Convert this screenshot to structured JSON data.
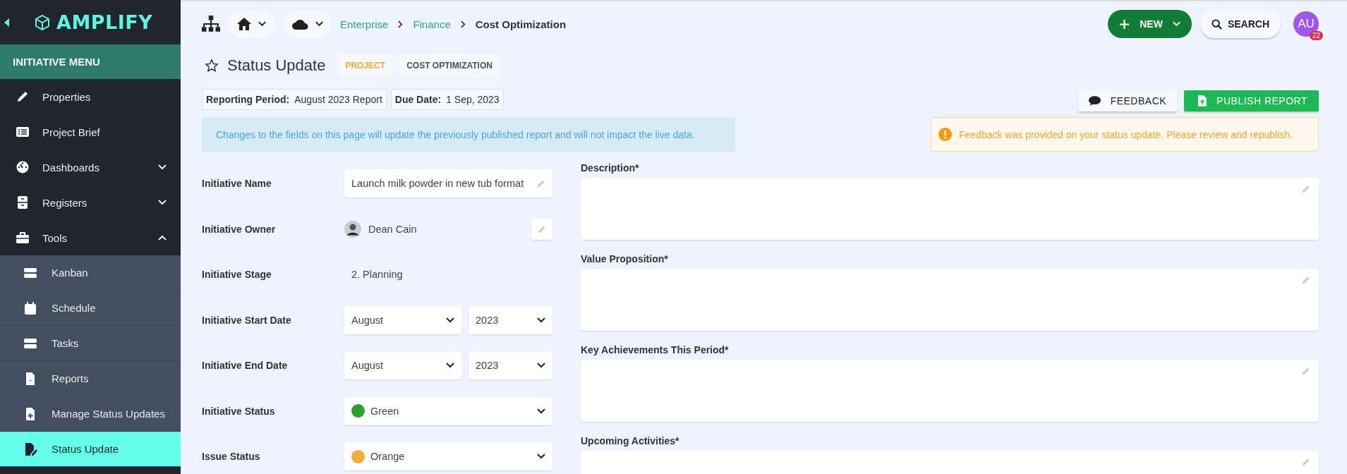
{
  "sidebar": {
    "brand": "AMPLIFY",
    "menu_title": "INITIATIVE MENU",
    "items": [
      {
        "label": "Properties",
        "selected": false
      },
      {
        "label": "Project Brief",
        "selected": false
      },
      {
        "label": "Dashboards",
        "selected": false,
        "expanded": false
      },
      {
        "label": "Registers",
        "selected": false,
        "expanded": false
      },
      {
        "label": "Tools",
        "selected": false,
        "expanded": true,
        "children": [
          {
            "label": "Kanban",
            "selected": false
          },
          {
            "label": "Schedule",
            "selected": false
          },
          {
            "label": "Tasks",
            "selected": false
          },
          {
            "label": "Reports",
            "selected": false
          },
          {
            "label": "Manage Status Updates",
            "selected": false
          },
          {
            "label": "Status Update",
            "selected": true
          }
        ]
      }
    ]
  },
  "topbar": {
    "breadcrumb": [
      "Enterprise",
      "Finance",
      "Cost Optimization"
    ],
    "new_button": "NEW",
    "search_button": "SEARCH",
    "avatar": {
      "initials": "AU",
      "badge": "22"
    }
  },
  "page": {
    "title": "Status Update",
    "starred": false,
    "tags": [
      {
        "label": "PROJECT",
        "color": "#f2a93b"
      },
      {
        "label": "COST OPTIMIZATION",
        "color": "#4a5160"
      }
    ],
    "meta": [
      {
        "label": "Reporting Period:",
        "value": "August 2023 Report"
      },
      {
        "label": "Due Date:",
        "value": "1 Sep, 2023"
      }
    ],
    "buttons": {
      "feedback": "FEEDBACK",
      "publish": "PUBLISH REPORT"
    },
    "info_banner": "Changes to the fields on this page will update the previously published report and will not impact the live data.",
    "alert": "Feedback was provided on your status update. Please review and republish."
  },
  "fields": [
    {
      "kind": "text",
      "label": "Initiative Name",
      "value": "Launch milk powder in new tub format"
    },
    {
      "kind": "person",
      "label": "Initiative Owner",
      "value": "Dean Cain"
    },
    {
      "kind": "static",
      "label": "Initiative Stage",
      "value": "2. Planning"
    },
    {
      "kind": "month_year",
      "label": "Initiative Start Date",
      "month": "August",
      "year": "2023"
    },
    {
      "kind": "month_year",
      "label": "Initiative End Date",
      "month": "August",
      "year": "2023"
    },
    {
      "kind": "status",
      "label": "Initiative Status",
      "value": "Green",
      "color": "#2ca02c"
    },
    {
      "kind": "status",
      "label": "Issue Status",
      "value": "Orange",
      "color": "#f0ad3c"
    }
  ],
  "text_areas": [
    {
      "label": "Description*"
    },
    {
      "label": "Value Proposition*"
    },
    {
      "label": "Key Achievements This Period*"
    },
    {
      "label": "Upcoming Activities*"
    }
  ]
}
